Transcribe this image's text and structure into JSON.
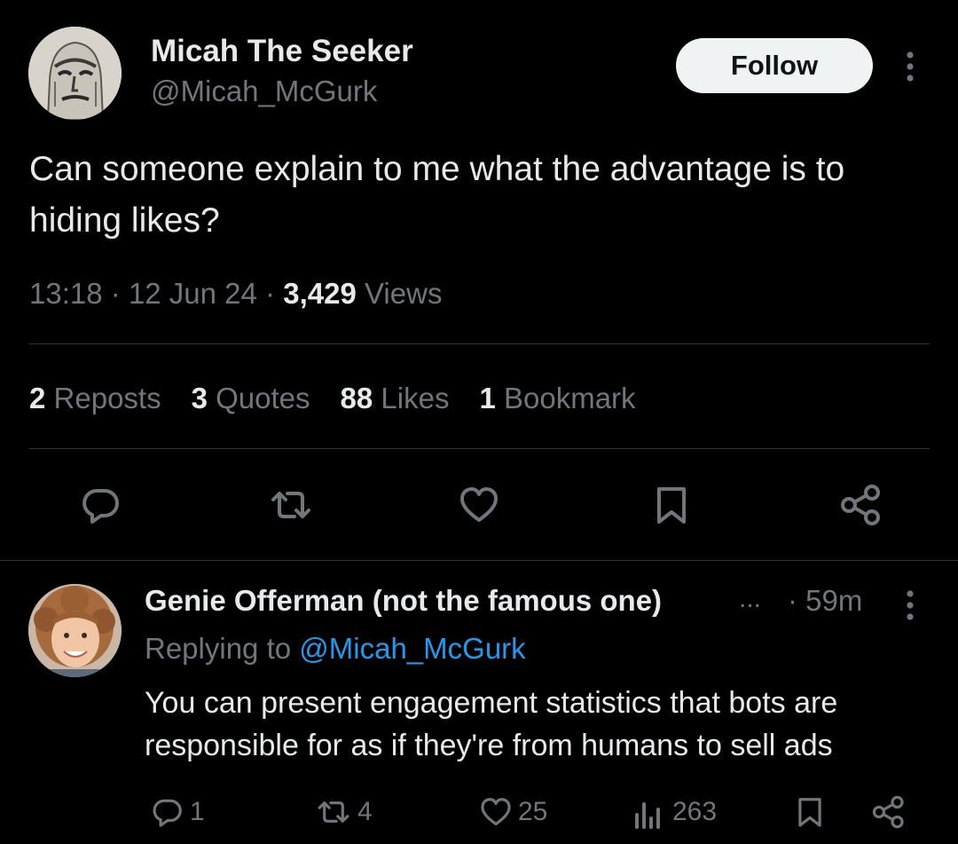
{
  "tweet": {
    "author_name": "Micah The Seeker",
    "author_handle": "@Micah_McGurk",
    "follow_label": "Follow",
    "text": "Can someone explain to me what the advantage is to hiding likes?",
    "time": "13:18",
    "date": "12 Jun 24",
    "views_count": "3,429",
    "views_label": "Views",
    "separator": "·"
  },
  "stats": [
    {
      "count": "2",
      "label": "Reposts"
    },
    {
      "count": "3",
      "label": "Quotes"
    },
    {
      "count": "88",
      "label": "Likes"
    },
    {
      "count": "1",
      "label": "Bookmark"
    }
  ],
  "actions": [
    "reply-icon",
    "repost-icon",
    "like-icon",
    "bookmark-icon",
    "share-icon"
  ],
  "reply": {
    "author_name": "Genie Offerman (not the famous one)",
    "truncation": "...",
    "time": "· 59m",
    "replying_prefix": "Replying to",
    "replying_handle": "@Micah_McGurk",
    "text": "You can present engagement statistics that bots are responsible for as if they're from humans to sell ads",
    "counts": {
      "replies": "1",
      "reposts": "4",
      "likes": "25",
      "views": "263"
    }
  },
  "colors": {
    "background": "#000000",
    "text": "#e7e9ea",
    "muted": "#71767b",
    "accent": "#1d9bf0",
    "divider": "#2f3336"
  }
}
